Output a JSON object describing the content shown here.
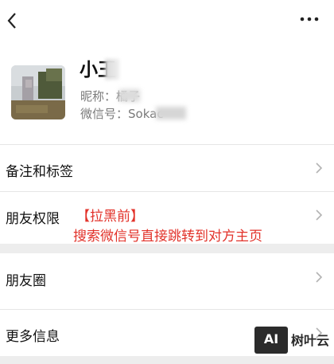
{
  "header": {
    "back_icon": "chevron-left-icon",
    "more_icon": "more-dots-icon"
  },
  "profile": {
    "name": "小王",
    "nickname_label": "昵称：",
    "nickname_value": "橘子",
    "wechat_id_label": "微信号：",
    "wechat_id_value": "Sokac"
  },
  "menu": [
    {
      "label": "备注和标签"
    },
    {
      "label": "朋友权限"
    },
    {
      "label": "朋友圈"
    },
    {
      "label": "更多信息"
    }
  ],
  "annotation": {
    "line1": "【拉黑前】",
    "line2": "搜索微信号直接跳转到对方主页",
    "color": "#e2322a"
  },
  "watermark": {
    "logo": "AI",
    "brand": "树叶云"
  }
}
